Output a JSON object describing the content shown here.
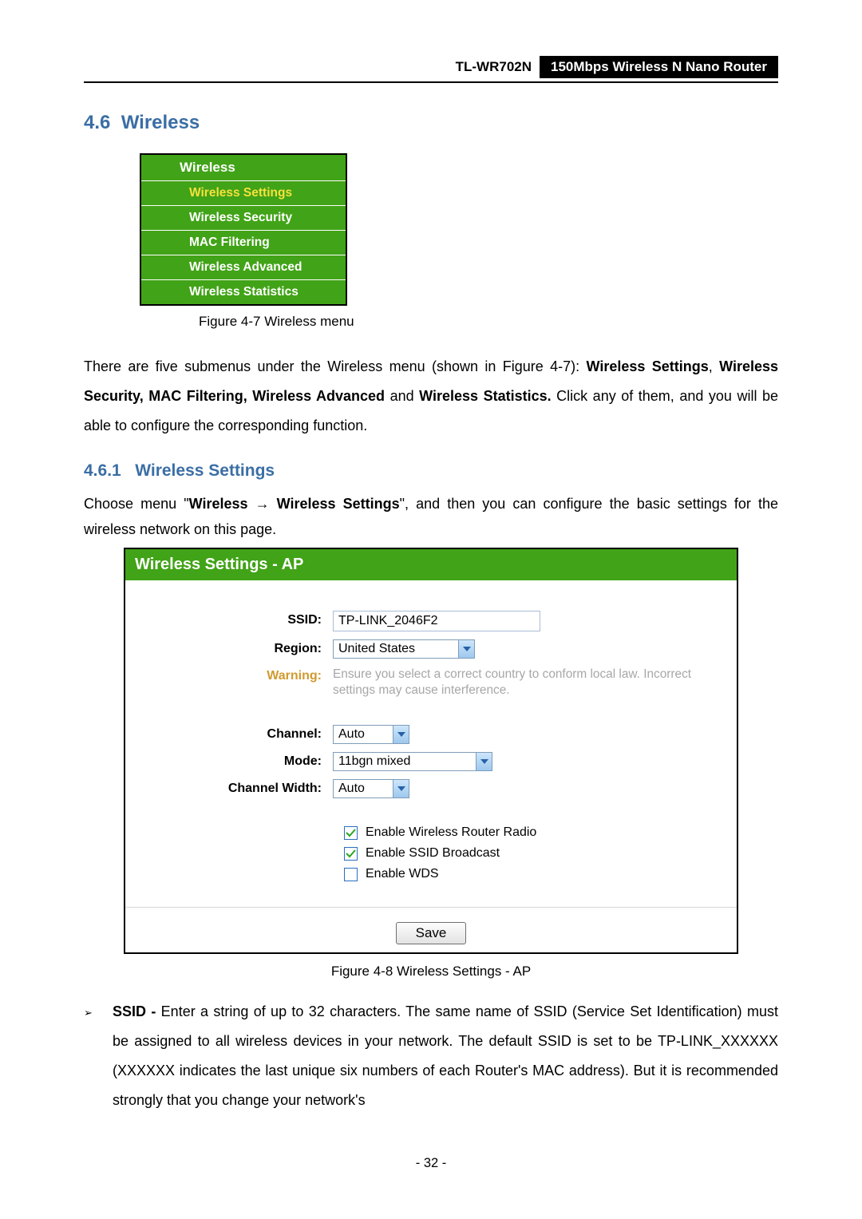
{
  "header": {
    "model": "TL-WR702N",
    "desc": "150Mbps  Wireless  N  Nano  Router"
  },
  "section": {
    "num": "4.6",
    "title": "Wireless"
  },
  "menu": {
    "head": "Wireless",
    "items": [
      {
        "label": "Wireless Settings",
        "active": true
      },
      {
        "label": "Wireless Security",
        "active": false
      },
      {
        "label": "MAC Filtering",
        "active": false
      },
      {
        "label": "Wireless Advanced",
        "active": false
      },
      {
        "label": "Wireless Statistics",
        "active": false
      }
    ]
  },
  "fig1": "Figure 4-7   Wireless menu",
  "para1_a": "There are five submenus under the Wireless menu (shown in Figure 4-7): ",
  "para1_b": "Wireless Settings",
  "para1_c": ", ",
  "para1_d": "Wireless Security, MAC Filtering, Wireless Advanced",
  "para1_e": " and ",
  "para1_f": "Wireless Statistics.",
  "para1_g": " Click any of them, and you will be able to configure the corresponding function.",
  "subsection": {
    "num": "4.6.1",
    "title": "Wireless Settings"
  },
  "para2_a": "Choose menu \"",
  "para2_b": "Wireless",
  "para2_c": "  →  ",
  "para2_d": "Wireless Settings",
  "para2_e": "\", and then you can configure the basic settings for the wireless network on this page.",
  "panel": {
    "title": "Wireless Settings - AP",
    "ssid_label": "SSID:",
    "ssid_value": "TP-LINK_2046F2",
    "region_label": "Region:",
    "region_value": "United States",
    "warning_label": "Warning:",
    "warning_text": "Ensure you select a correct country to conform local law. Incorrect settings may cause interference.",
    "channel_label": "Channel:",
    "channel_value": "Auto",
    "mode_label": "Mode:",
    "mode_value": "11bgn mixed",
    "cw_label": "Channel Width:",
    "cw_value": "Auto",
    "chk1": "Enable Wireless Router Radio",
    "chk2": "Enable SSID Broadcast",
    "chk3": "Enable WDS",
    "save": "Save"
  },
  "fig2": "Figure 4-8 Wireless Settings - AP",
  "bullet": {
    "lead": "SSID - ",
    "body": "Enter a string of up to 32 characters. The same name of SSID (Service Set Identification) must be assigned to all wireless devices in your network. The default SSID is set to be TP-LINK_XXXXXX (XXXXXX indicates the last unique six numbers of each Router's MAC address). But it is recommended strongly that you change your network's"
  },
  "footer": "- 32 -"
}
